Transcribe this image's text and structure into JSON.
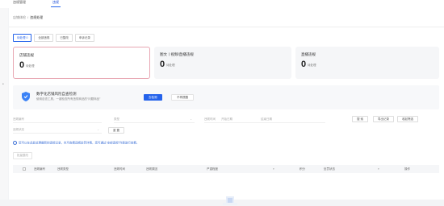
{
  "topbar": {
    "tab1": "违规管理",
    "tab2": "违规"
  },
  "breadcrumb": {
    "parent": "店铺体检",
    "current": "违规处理"
  },
  "subtabs": [
    "待处理 0",
    "全部违规",
    "已整改",
    "申诉记录"
  ],
  "cards": [
    {
      "title": "店铺违规",
      "value": "0",
      "sub": "待处理"
    },
    {
      "title": "图文丨视频/直播违规",
      "value": "0",
      "sub": "待处理"
    },
    {
      "title": "直播违规",
      "value": "0",
      "sub": "待处理"
    }
  ],
  "banner": {
    "title": "数字化店铺风险自查检测",
    "desc": "使用自查工具，一键检查所有违规商品的“问题商品”",
    "primary": "去检测",
    "ghost": "不再提醒"
  },
  "filters": {
    "f1": "违规编号",
    "f2": "类型",
    "f3": "违规时间",
    "f3b": "开始日期",
    "f3c": "结束日期",
    "f4": "违规状态",
    "search": "搜 索",
    "reset": "重 置",
    "export": "导出记录",
    "collapse": "收起筛选"
  },
  "notice": "您可以在此处处理最新的违规记录，也可查看违规处罚详情，您可通过“全部违规”列表进行查看。",
  "batch": "批量整改",
  "table": {
    "headers": [
      "违规编号",
      "违规类型",
      "违规时间",
      "违规原因",
      "严重程度",
      "积分",
      "处罚状态",
      "操作"
    ]
  }
}
